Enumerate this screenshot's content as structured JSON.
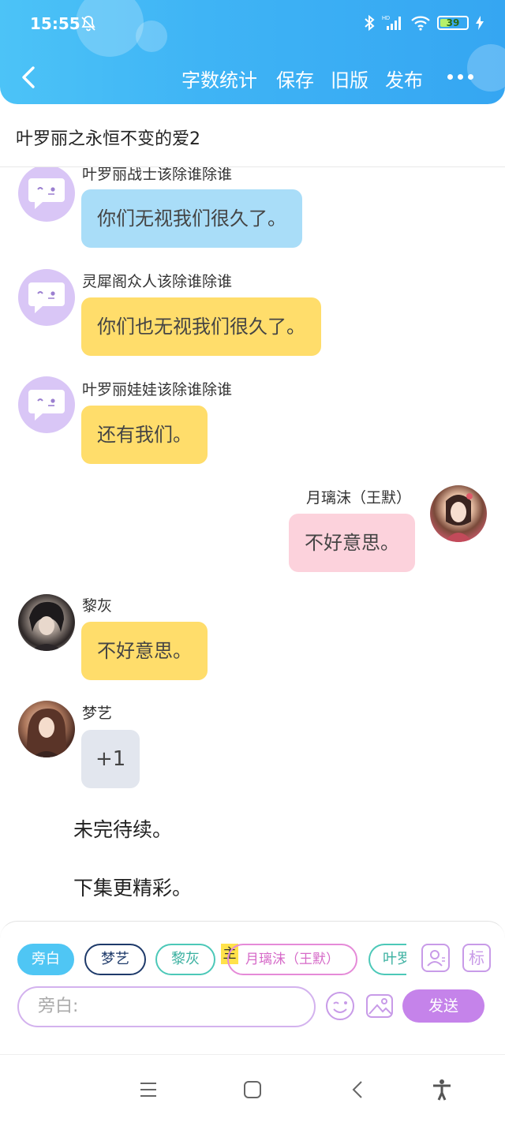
{
  "status_bar": {
    "time": "15:55",
    "battery": "39",
    "battery_level": 0.39
  },
  "toolbar": {
    "word_count_label": "字数统计",
    "save_label": "保存",
    "old_version_label": "旧版",
    "publish_label": "发布"
  },
  "title": "叶罗丽之永恒不变的爱2",
  "messages": [
    {
      "speaker": "叶罗丽战士该除谁除谁",
      "text": "你们无视我们很久了。",
      "color": "#a9ddf8"
    },
    {
      "speaker": "灵犀阁众人该除谁除谁",
      "text": "你们也无视我们很久了。",
      "color": "#ffdd6b"
    },
    {
      "speaker": "叶罗丽娃娃该除谁除谁",
      "text": "还有我们。",
      "color": "#ffdd6b"
    },
    {
      "speaker": "月璃沫（王默）",
      "text": "不好意思。",
      "color": "#fcd2dc"
    },
    {
      "speaker": "黎灰",
      "text": "不好意思。",
      "color": "#ffdd6b"
    },
    {
      "speaker": "梦艺",
      "text": "+1",
      "color": "#e2e6ee"
    }
  ],
  "narrations": [
    "未完待续。",
    "下集更精彩。"
  ],
  "composer": {
    "chips": [
      "旁白",
      "梦艺",
      "黎灰",
      "月璃沫（王默）",
      "叶罗"
    ],
    "main_tag": "主",
    "mark_label": "标",
    "input_placeholder": "旁白:",
    "send_label": "发送"
  },
  "colors": {
    "header": "#3fb4f5",
    "accent_purple": "#c583ea",
    "narration_chip": "#4fc6f4"
  }
}
